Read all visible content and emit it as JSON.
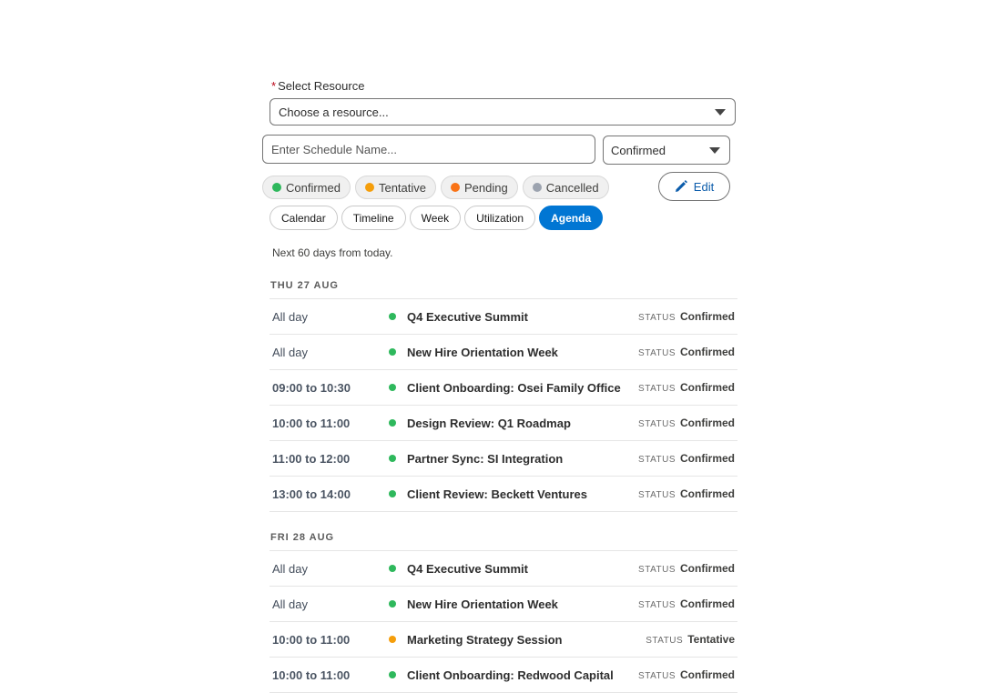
{
  "resource": {
    "label": "Select Resource",
    "required_marker": "*",
    "placeholder": "Choose a resource..."
  },
  "schedule": {
    "name_placeholder": "Enter Schedule Name...",
    "status_value": "Confirmed"
  },
  "legend": [
    {
      "label": "Confirmed",
      "color": "#2eb85c"
    },
    {
      "label": "Tentative",
      "color": "#f59e0b"
    },
    {
      "label": "Pending",
      "color": "#f97316"
    },
    {
      "label": "Cancelled",
      "color": "#9ca3af"
    }
  ],
  "edit_label": "Edit",
  "views": [
    {
      "label": "Calendar",
      "active": false
    },
    {
      "label": "Timeline",
      "active": false
    },
    {
      "label": "Week",
      "active": false
    },
    {
      "label": "Utilization",
      "active": false
    },
    {
      "label": "Agenda",
      "active": true
    }
  ],
  "range_note": "Next 60 days from today.",
  "status_label": "STATUS",
  "days": [
    {
      "header": "THU 27 AUG",
      "events": [
        {
          "time": "All day",
          "title": "Q4 Executive Summit",
          "status": "Confirmed",
          "color": "#2eb85c"
        },
        {
          "time": "All day",
          "title": "New Hire Orientation Week",
          "status": "Confirmed",
          "color": "#2eb85c"
        },
        {
          "time": "09:00 to 10:30",
          "title": "Client Onboarding: Osei Family Office",
          "status": "Confirmed",
          "color": "#2eb85c"
        },
        {
          "time": "10:00 to 11:00",
          "title": "Design Review: Q1 Roadmap",
          "status": "Confirmed",
          "color": "#2eb85c"
        },
        {
          "time": "11:00 to 12:00",
          "title": "Partner Sync: SI Integration",
          "status": "Confirmed",
          "color": "#2eb85c"
        },
        {
          "time": "13:00 to 14:00",
          "title": "Client Review: Beckett Ventures",
          "status": "Confirmed",
          "color": "#2eb85c"
        }
      ]
    },
    {
      "header": "FRI 28 AUG",
      "events": [
        {
          "time": "All day",
          "title": "Q4 Executive Summit",
          "status": "Confirmed",
          "color": "#2eb85c"
        },
        {
          "time": "All day",
          "title": "New Hire Orientation Week",
          "status": "Confirmed",
          "color": "#2eb85c"
        },
        {
          "time": "10:00 to 11:00",
          "title": "Marketing Strategy Session",
          "status": "Tentative",
          "color": "#f59e0b"
        },
        {
          "time": "10:00 to 11:00",
          "title": "Client Onboarding: Redwood Capital",
          "status": "Confirmed",
          "color": "#2eb85c"
        }
      ]
    }
  ]
}
